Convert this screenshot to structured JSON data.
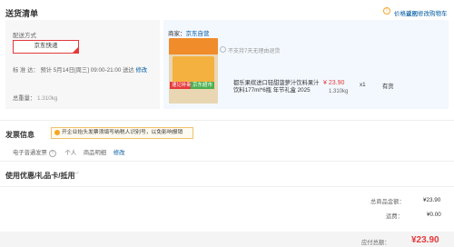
{
  "header": {
    "title": "送货清单",
    "price_note": "价格说明",
    "back_to_cart": "返回修改购物车"
  },
  "shipping": {
    "method_label": "配送方式",
    "method_value": "京东快递",
    "time_label": "标 准 达：",
    "time_value": "预计 5月14日[周三] 09:00-21:00 送达",
    "time_edit": "修改",
    "weight_label": "总重量：",
    "weight_value": "1.310kg"
  },
  "product": {
    "seller_label": "商家：",
    "seller_name": "京东自营",
    "no_return": "不支持7天无理由退货",
    "tag_promo": "速记补新",
    "tag_origin": "京东超市",
    "name": "都乐果缤进口轻甜菠萝汁饮料果汁饮料177ml*6瓶 年节礼盒 2025",
    "price": "¥ 23.90",
    "weight": "1.310kg",
    "qty": "x1",
    "stock": "有货"
  },
  "invoice": {
    "title": "发票信息",
    "notice": "开企业抬头发票须填写纳税人识别号，以免影响报销",
    "type": "电子普通发票",
    "person": "个人",
    "detail": "商品明细",
    "edit": "修改"
  },
  "coupon": {
    "title": "使用优惠/礼品卡/抵用",
    "chevron": "chevron-down-icon"
  },
  "totals": {
    "total_label": "总商品金额：",
    "total_value": "¥23.90",
    "shipping_label": "运费：",
    "shipping_value": "¥0.00",
    "pay_label": "应付总额：",
    "pay_value": "¥23.90"
  },
  "colors": {
    "accent_red": "#e4393c",
    "link_blue": "#005aa0",
    "panel_blue": "#f3f8fe"
  }
}
